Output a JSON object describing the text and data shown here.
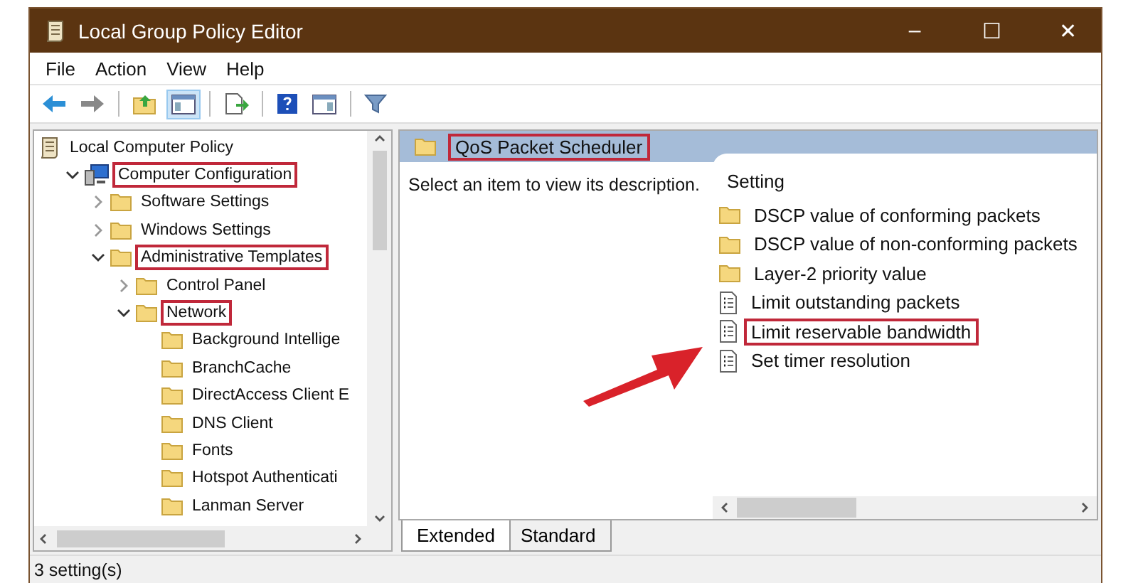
{
  "window": {
    "title": "Local Group Policy Editor",
    "controls": [
      "–",
      "☐",
      "✕"
    ]
  },
  "menu": [
    "File",
    "Action",
    "View",
    "Help"
  ],
  "tree": [
    {
      "label": "Local Computer Policy",
      "kind": "policy",
      "highlighted": false,
      "children": [
        {
          "label": "Computer Configuration",
          "kind": "computer",
          "expanded": true,
          "highlighted": true,
          "children": [
            {
              "label": "Software Settings",
              "expanded": false,
              "highlighted": false
            },
            {
              "label": "Windows Settings",
              "expanded": false,
              "highlighted": false
            },
            {
              "label": "Administrative Templates",
              "expanded": true,
              "highlighted": true,
              "children": [
                {
                  "label": "Control Panel",
                  "expanded": false,
                  "highlighted": false
                },
                {
                  "label": "Network",
                  "expanded": true,
                  "highlighted": true,
                  "children": [
                    {
                      "label": "Background Intellige",
                      "highlighted": false
                    },
                    {
                      "label": "BranchCache",
                      "highlighted": false
                    },
                    {
                      "label": "DirectAccess Client E",
                      "highlighted": false
                    },
                    {
                      "label": "DNS Client",
                      "highlighted": false
                    },
                    {
                      "label": "Fonts",
                      "highlighted": false
                    },
                    {
                      "label": "Hotspot Authenticati",
                      "highlighted": false
                    },
                    {
                      "label": "Lanman Server",
                      "highlighted": false
                    }
                  ]
                }
              ]
            }
          ]
        }
      ]
    }
  ],
  "details": {
    "header": {
      "title": "QoS Packet Scheduler",
      "highlighted": true
    },
    "description": "Select an item to view its description.",
    "column": "Setting",
    "settings": [
      {
        "label": "DSCP value of conforming packets",
        "kind": "folder",
        "highlighted": false
      },
      {
        "label": "DSCP value of non-conforming packets",
        "kind": "folder",
        "highlighted": false
      },
      {
        "label": "Layer-2 priority value",
        "kind": "folder",
        "highlighted": false
      },
      {
        "label": "Limit outstanding packets",
        "kind": "setting",
        "highlighted": false
      },
      {
        "label": "Limit reservable bandwidth",
        "kind": "setting",
        "highlighted": true
      },
      {
        "label": "Set timer resolution",
        "kind": "setting",
        "highlighted": false
      }
    ]
  },
  "tabs": [
    {
      "label": "Extended",
      "selected": true
    },
    {
      "label": "Standard",
      "selected": false
    }
  ],
  "status_bar": "3 setting(s)"
}
